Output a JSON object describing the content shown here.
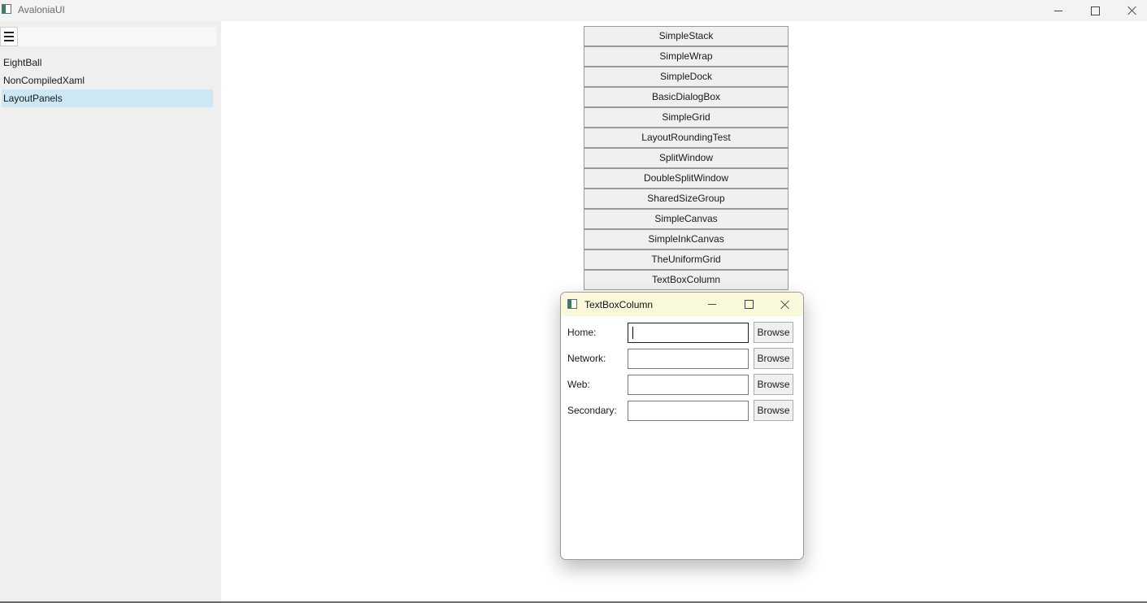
{
  "window": {
    "title": "AvaloniaUI",
    "app_icon": "app-window-icon",
    "controls": [
      "minimize-icon",
      "maximize-icon",
      "close-icon"
    ]
  },
  "sidebar": {
    "menu_icon": "hamburger-icon",
    "search_value": "",
    "items": [
      {
        "label": "EightBall",
        "selected": false
      },
      {
        "label": "NonCompiledXaml",
        "selected": false
      },
      {
        "label": "LayoutPanels",
        "selected": true
      }
    ],
    "selected_color": "#cde8f4"
  },
  "main": {
    "buttons": [
      "SimpleStack",
      "SimpleWrap",
      "SimpleDock",
      "BasicDialogBox",
      "SimpleGrid",
      "LayoutRoundingTest",
      "SplitWindow",
      "DoubleSplitWindow",
      "SharedSizeGroup",
      "SimpleCanvas",
      "SimpleInkCanvas",
      "TheUniformGrid",
      "TextBoxColumn"
    ]
  },
  "dialog": {
    "title": "TextBoxColumn",
    "titlebar_color": "#fbf9dc",
    "fields": [
      {
        "label": "Home:",
        "value": "",
        "browse_label": "Browse",
        "focused": true
      },
      {
        "label": "Network:",
        "value": "",
        "browse_label": "Browse",
        "focused": false
      },
      {
        "label": "Web:",
        "value": "",
        "browse_label": "Browse",
        "focused": false
      },
      {
        "label": "Secondary:",
        "value": "",
        "browse_label": "Browse",
        "focused": false
      }
    ]
  }
}
